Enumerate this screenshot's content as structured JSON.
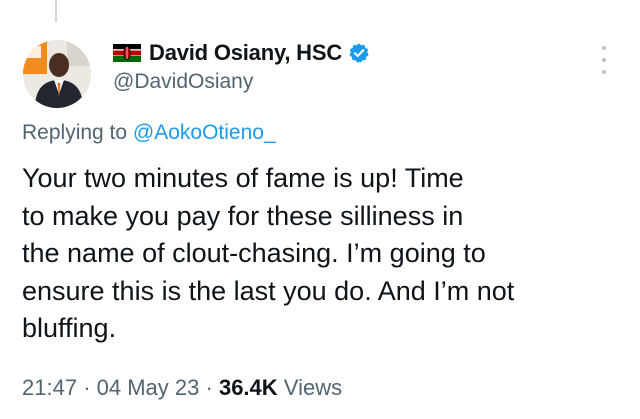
{
  "author": {
    "display_name": "David Osiany, HSC",
    "handle": "@DavidOsiany",
    "flag_icon": "kenya-flag-icon",
    "verified_icon": "verified-badge-icon",
    "verified_color": "#1d9bf0"
  },
  "reply": {
    "prefix": "Replying to",
    "target": "@AokoOtieno_"
  },
  "tweet": {
    "lines": [
      "Your two minutes of fame is up! Time",
      "to make you pay for these silliness in",
      "the name of clout-chasing. I’m going to",
      "ensure this is the last you do. And I’m not",
      "bluffing."
    ]
  },
  "meta": {
    "time": "21:47",
    "separator": "·",
    "date": "04 May 23",
    "views_count": "36.4K",
    "views_label": "Views"
  },
  "colors": {
    "link": "#1d9bf0",
    "secondary_text": "#536471",
    "primary_text": "#0f1419"
  }
}
